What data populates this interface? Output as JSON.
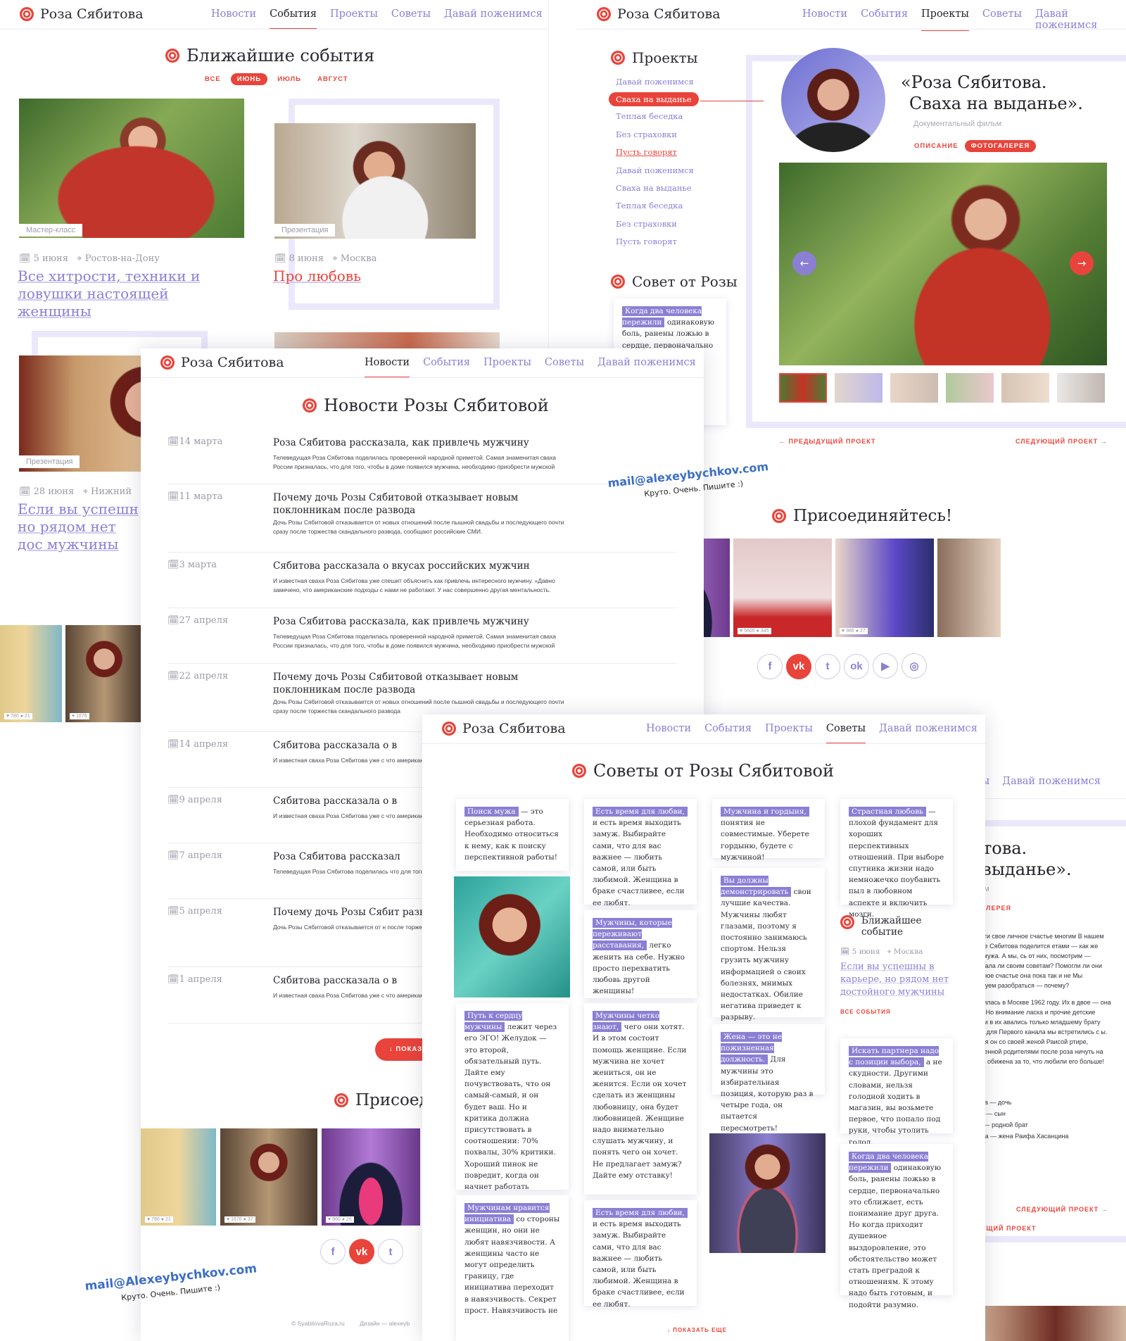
{
  "brand": "Роза Сябитова",
  "nav": [
    "Новости",
    "События",
    "Проекты",
    "Советы",
    "Давай поженимся"
  ],
  "events": {
    "title": "Ближайшие события",
    "filters": [
      "ВСЕ",
      "ИЮНЬ",
      "ИЮЛЬ",
      "АВГУСТ"
    ],
    "items": [
      {
        "tag": "Мастер-класс",
        "date": "5 июня",
        "city": "Ростов-на-Дону",
        "title": "Все хитрости, техники и ловушки настоящей женщины"
      },
      {
        "tag": "Презентация",
        "date": "8 июня",
        "city": "Москва",
        "title": "Про любовь"
      },
      {
        "tag": "Презентация",
        "date": "28 июня",
        "city": "Нижний",
        "title": "Если вы успешн но рядом нет дос мужчины"
      }
    ],
    "bottom_stats": [
      {
        "likes": "780",
        "comments": "21"
      },
      {
        "likes": "1676",
        "comments": ""
      }
    ]
  },
  "projects": {
    "title": "Проекты",
    "list": [
      "Давай поженимся",
      "Сваха на выданье",
      "Теплая беседка",
      "Без страховки",
      "Пусть говорят",
      "Давай поженимся",
      "Сваха на выданье",
      "Теплая беседка",
      "Без страховки",
      "Пусть говорят"
    ],
    "film_title_1": "«Роза Сябитова.",
    "film_title_2": "Сваха на выданье».",
    "film_sub": "Документальный фильм",
    "tab_desc": "ОПИСАНИЕ",
    "tab_gallery": "ФОТОГАЛЕРЕЯ",
    "prev": "ПРЕДЫДУЩИЙ ПРОЕКТ",
    "next": "СЛЕДУЮЩИЙ ПРОЕКТ",
    "advice_title": "Совет от Розы",
    "advice_hl": "Когда два человека пережили",
    "advice_text": "одинаковую боль, ранены ложью в сердце, первоначально",
    "join_title": "Присоединяйтесь!",
    "join_stats": [
      {
        "likes": "1676",
        "comments": "37"
      },
      {
        "likes": "960",
        "comments": "26"
      },
      {
        "likes": "5605",
        "comments": "345"
      },
      {
        "likes": "986",
        "comments": "27"
      }
    ],
    "email": "mail@alexeybychkov.com",
    "email_sub": "Круто. Очень. Пишите :)"
  },
  "news": {
    "title": "Новости Розы Сябитовой",
    "items": [
      {
        "date": "14 марта",
        "title": "Роза Сябитова рассказала, как привлечь мужчину",
        "text": "Телеведущая Роза Сябитова поделилась проверенной народной приметой. Самая знаменитая сваха России призналась, что для того, чтобы в доме появился мужчина, необходимо приобрести мужской халат и домашние тапочки."
      },
      {
        "date": "11 марта",
        "title": "Почему дочь Розы Сябитовой отказывает новым поклонникам после развода",
        "text": "Дочь Розы Сябитовой отказывается от новых отношений после пышной свадьбы и последующего почти сразу после торжества скандального развода, сообщают российские СМИ."
      },
      {
        "date": "3 марта",
        "title": "Сябитова рассказала о вкусах российских мужчин",
        "text": "И известная сваха Роза Сябитова уже спешит объяснить как привлечь интересного мужчину. «Давно замечено, что американские подходы с нами не работают. У нас совершенно другая ментальность."
      },
      {
        "date": "27 апреля",
        "title": "Роза Сябитова рассказала, как привлечь мужчину",
        "text": "Телеведущая Роза Сябитова поделилась проверенной народной приметой. Самая знаменитая сваха России призналась, что для того, чтобы в доме появился мужчина, необходимо приобрести мужской халат и домашние тапочки."
      },
      {
        "date": "22 апреля",
        "title": "Почему дочь Розы Сябитовой отказывает новым поклонникам после развода",
        "text": "Дочь Розы Сябитовой отказывается от новых отношений после пышной свадьбы и последующего почти сразу после торжества скандального развода"
      },
      {
        "date": "14 апреля",
        "title": "Сябитова рассказала о в",
        "text": "И известная сваха Роза Сябитова уже с что американские подходы с нами не ра"
      },
      {
        "date": "9 апреля",
        "title": "Сябитова рассказала о в",
        "text": "И известная сваха Роза Сябитова уже с что американские подходы с нами не ра"
      },
      {
        "date": "7 апреля",
        "title": "Роза Сябитова рассказал",
        "text": "Телеведущая Роза Сябитова поделилась что для того, чтобы в доме появился му"
      },
      {
        "date": "5 апреля",
        "title": "Почему дочь Розы Сябит развода",
        "text": "Дочь Розы Сябитовой отказывается от н после торжества скандального развода"
      },
      {
        "date": "1 апреля",
        "title": "Сябитова рассказала о в",
        "text": "И известная сваха Роза Сябитова уже с что американские подходы с нами не ра"
      }
    ],
    "more": "ПОКАЗ",
    "join_title": "Присоед",
    "join_stats": [
      {
        "likes": "780",
        "comments": "21"
      },
      {
        "likes": "1676",
        "comments": "37"
      },
      {
        "likes": "960",
        "comments": "26"
      }
    ],
    "email": "mail@Alexeybychkov.com",
    "email_sub": "Круто. Очень. Пишите :)",
    "footer_copy": "© SyabitovaRoza.ru",
    "footer_design": "Дизайн — alexeyb"
  },
  "advice": {
    "title": "Советы от Розы Сябитовой",
    "cards": [
      {
        "hl": "Поиск мужа",
        "text": "— это серьезная работа. Необходимо относиться к нему, как к поиску перспективной работы!"
      },
      {
        "hl": "Есть время для любви,",
        "text": "и есть время выходить замуж. Выбирайте сами, что для вас важнее — любить самой, или быть любимой. Женщина в браке счастливее, если ее любят."
      },
      {
        "hl": "Мужчина и гордыня,",
        "text": "понятия не совместимые. Уберете гордыню, будете с мужчиной!"
      },
      {
        "hl": "Страстная любовь",
        "text": "— плохой фундамент для хороших перспективных отношений. При выборе спутника жизни надо немножечко поубавить пыл в любовном аспекте и включить мозги."
      },
      {
        "hl": "Мужчины, которые переживают расставания,",
        "text": "легко женить на себе. Нужно просто перехватить любовь другой женщины!"
      },
      {
        "hl": "Вы должны демонстрировать",
        "text": "свои лучшие качества. Мужчины любят глазами, поэтому я постоянно занимаюсь спортом. Нельзя грузить мужчину информацией о своих болезнях, мнимых недостатках. Обилие негатива приведет к разрыву."
      },
      {
        "hl": "Путь к сердцу мужчины",
        "text": "лежит через его ЭГО! Желудок — это второй, обязательный путь. Дайте ему почувствовать, что он самый-самый, и он будет ваш. Но и критика должна присутствовать в соотношении: 70% похвалы, 30% критики. Хороший пинок не повредит, когда он начнет работать «водителем дивана»."
      },
      {
        "hl": "Мужчины четко знают,",
        "text": "чего они хотят. И в этом состоит помощь женщине. Если мужчина не хочет жениться, он не женится. Если он хочет сделать из женщины любовницу, она будет любовницей. Женщине надо внимательно слушать мужчину, и понять чего он хочет. Не предлагает замуж? Дайте ему отставку!"
      },
      {
        "hl": "Жена — это не пожизненная должность.",
        "text": "Для мужчины это избирательная позиция, которую раз в четыре года, он пытается пересмотреть!"
      },
      {
        "hl": "Искать партнера надо с позиции выбора,",
        "text": "а не скудности. Другими словами, нельзя голодной ходить в магазин, вы возьмете первое, что попало под руки, чтобы утолить голод."
      },
      {
        "hl": "Есть время для любви,",
        "text": "и есть время выходить замуж. Выбирайте сами, что для вас важнее — любить самой, или быть любимой. Женщина в браке счастливее, если ее любят."
      },
      {
        "hl": "Когда два человека пережили",
        "text": "одинаковую боль, ранены ложью в сердце, первоначально это сближает, есть понимание друг друга. Но когда приходит душевное выздоровление, это обстоятельство может стать преградой к отношениям. К этому надо быть готовым, и подойти разумно."
      },
      {
        "hl": "Мужчинам нравится инициатива",
        "text": "со стороны женщин, но они не любят навязчивости. А женщины часто не могут определить границу, где инициатива переходит в навязчивость. Секрет прост. Навязчивость не"
      }
    ],
    "events_title": "Ближайшее событие",
    "event_date": "5 июня",
    "event_city": "Москва",
    "event_link": "Если вы успешны в карьере, но рядом нет достойного мужчины",
    "all_events": "ВСЕ СОБЫТИЯ",
    "more": "ПОКАЗАТЬ ЕЩЕ"
  },
  "project_desc": {
    "title_1": "итова.",
    "title_2": "ı выданье».",
    "sub": "ильм",
    "tab": "ОГАЛЕРЕЯ",
    "nav_partial": [
      "еты",
      "Давай поженимся"
    ],
    "para1": "ла найти свое личное счастье многим В нашем фильме Сябитова поделится етами — как же найти мужа. А мы, сь от них, посмотрим — следовала ли своим советам? Помогли ли они ей? ичное счастье она пока так и не Мы попробуем разобраться — почему?",
    "para2": "ва родилась в Москве 1962 году. Их в двое — она и брат. Но внимание ласка и прочие детские радости в их авались только младшему брату Раифу. для Первого канала мы встретились с ы. Сегодня он со своей женой Раисой ртире, оставленной родителями после роза ничуть на него не обижена за то, что любили его больше!",
    "cast_label": "льма:",
    "cast": [
      "това",
      "абитова — дочь",
      "битова — сын",
      "анцин — родной брат",
      "санцина — жена Раифа Хасанцина"
    ],
    "next": "СЛЕДУЮЩИЙ ПРОЕКТ",
    "prev": "ДЫДУЩИЙ ПРОЕКТ"
  },
  "colors": {
    "accent": "#e8443b",
    "violet": "#8b7fd4",
    "lavender": "#ebe8fb"
  }
}
